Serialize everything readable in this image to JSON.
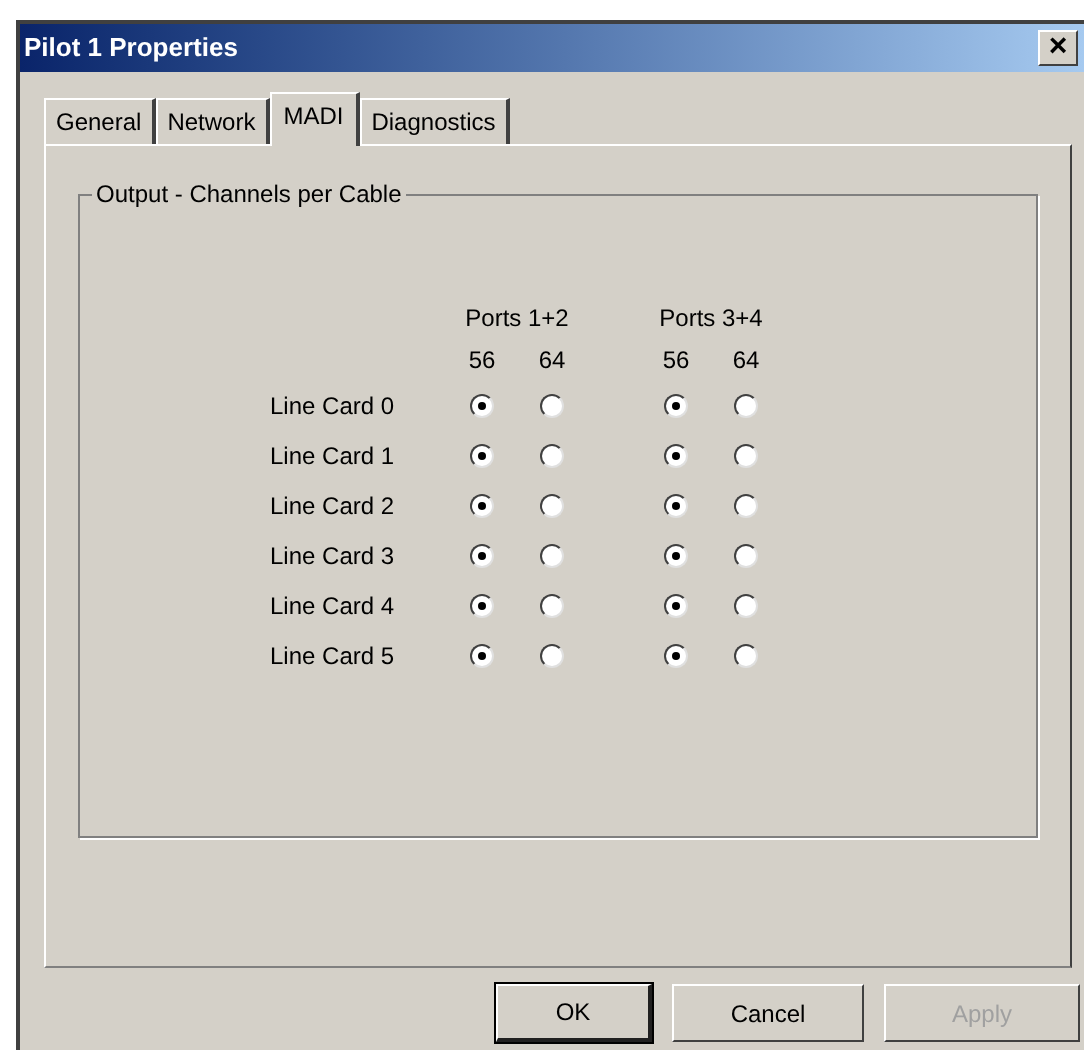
{
  "window": {
    "title": "Pilot 1 Properties",
    "close": "×"
  },
  "tabs": [
    {
      "label": "General",
      "selected": false
    },
    {
      "label": "Network",
      "selected": false
    },
    {
      "label": "MADI",
      "selected": true
    },
    {
      "label": "Diagnostics",
      "selected": false
    }
  ],
  "group": {
    "title": "Output - Channels per Cable",
    "port_groups": [
      {
        "label": "Ports 1+2",
        "columns": [
          "56",
          "64"
        ]
      },
      {
        "label": "Ports 3+4",
        "columns": [
          "56",
          "64"
        ]
      }
    ],
    "rows": [
      {
        "label": "Line Card 0",
        "options": [
          {
            "selected": true
          },
          {
            "selected": false
          },
          {
            "selected": true
          },
          {
            "selected": false
          }
        ]
      },
      {
        "label": "Line Card 1",
        "options": [
          {
            "selected": true
          },
          {
            "selected": false
          },
          {
            "selected": true
          },
          {
            "selected": false
          }
        ]
      },
      {
        "label": "Line Card 2",
        "options": [
          {
            "selected": true
          },
          {
            "selected": false
          },
          {
            "selected": true
          },
          {
            "selected": false
          }
        ]
      },
      {
        "label": "Line Card 3",
        "options": [
          {
            "selected": true
          },
          {
            "selected": false
          },
          {
            "selected": true
          },
          {
            "selected": false
          }
        ]
      },
      {
        "label": "Line Card 4",
        "options": [
          {
            "selected": true
          },
          {
            "selected": false
          },
          {
            "selected": true
          },
          {
            "selected": false
          }
        ]
      },
      {
        "label": "Line Card 5",
        "options": [
          {
            "selected": true
          },
          {
            "selected": false
          },
          {
            "selected": true
          },
          {
            "selected": false
          }
        ]
      }
    ]
  },
  "buttons": [
    {
      "label": "OK",
      "default": true,
      "disabled": false
    },
    {
      "label": "Cancel",
      "default": false,
      "disabled": false
    },
    {
      "label": "Apply",
      "default": false,
      "disabled": true
    }
  ]
}
